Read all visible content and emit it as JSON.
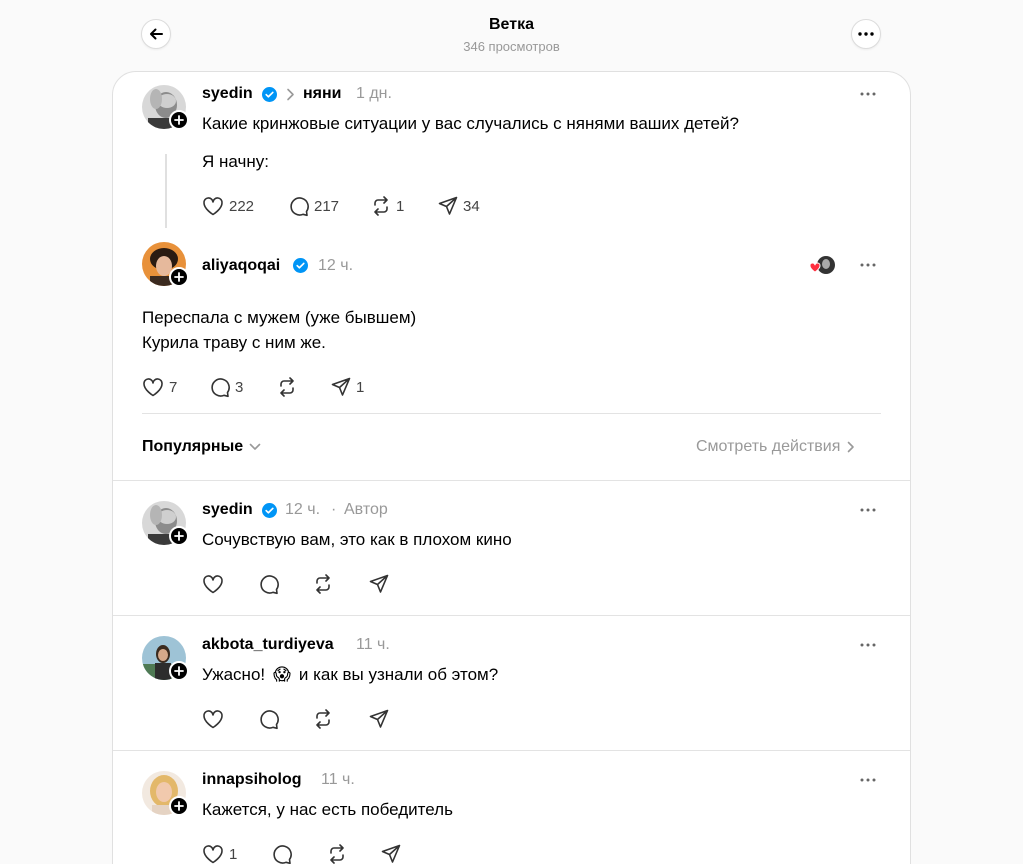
{
  "header": {
    "title": "Ветка",
    "views": "346 просмотров"
  },
  "post": {
    "username": "syedin",
    "topic": "няни",
    "time": "1 дн.",
    "text_line1": "Какие кринжовые ситуации у вас случались с нянями ваших детей?",
    "text_line2": "Я начну:",
    "likes": "222",
    "replies": "217",
    "reposts": "1",
    "shares": "34"
  },
  "reply_main": {
    "username": "aliyaqoqai",
    "time": "12 ч.",
    "text_line1": "Переспала с мужем (уже бывшем)",
    "text_line2": "Курила траву с ним же.",
    "likes": "7",
    "replies": "3",
    "shares": "1"
  },
  "sort": {
    "label": "Популярные",
    "activity_link": "Смотреть действия"
  },
  "comments": [
    {
      "username": "syedin",
      "time": "12 ч.",
      "author_tag": "Автор",
      "text": "Сочувствую вам, это как в плохом кино"
    },
    {
      "username": "akbota_turdiyeva",
      "time": "11 ч.",
      "text_part1": "Ужасно!",
      "emoji": "😱",
      "text_part2": "и как вы узнали об этом?"
    },
    {
      "username": "innapsiholog",
      "time": "11 ч.",
      "text": "Кажется, у нас есть победитель",
      "likes": "1"
    }
  ],
  "colors": {
    "verified": "#0095f6",
    "like_red": "#ff3040",
    "muted": "#999999",
    "divider": "#e3e3e3"
  },
  "icons": [
    "back-arrow-icon",
    "more-icon",
    "verified-icon",
    "chevron-right-icon",
    "heart-icon",
    "comment-icon",
    "repost-icon",
    "share-icon",
    "chevron-down-icon",
    "plus-icon"
  ]
}
